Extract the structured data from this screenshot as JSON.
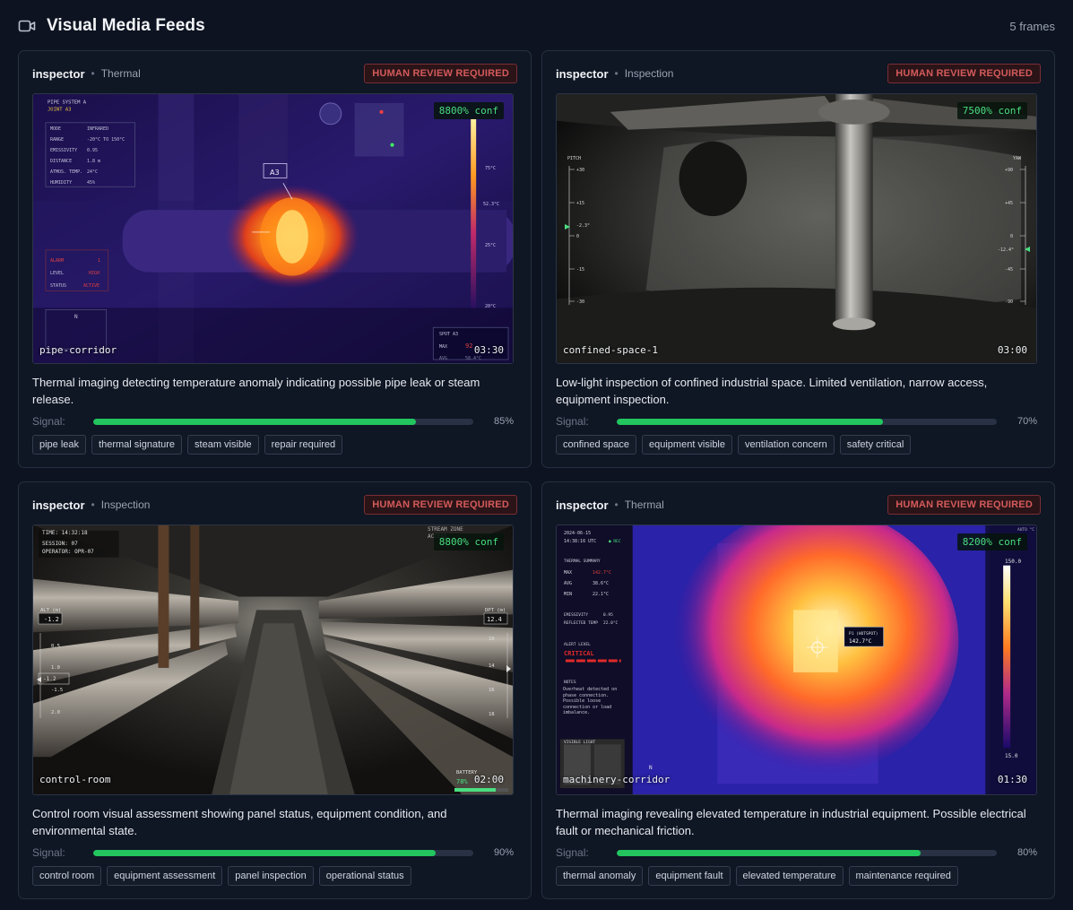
{
  "header": {
    "title": "Visual Media Feeds",
    "count": "5 frames",
    "icon": "video-camera-icon"
  },
  "review_label": "HUMAN REVIEW REQUIRED",
  "signal_label": "Signal:",
  "colors": {
    "signal": "#22c55e",
    "review": "#d45a5a",
    "confidence": "#4ade80"
  },
  "cards": [
    {
      "author": "inspector",
      "kind": "Thermal",
      "confidence": "8800% conf",
      "feed": "pipe-corridor",
      "duration": "03:30",
      "description": "Thermal imaging detecting temperature anomaly indicating possible pipe leak or steam release.",
      "signal_value": 0.85,
      "signal_pct": "85%",
      "tags": [
        "pipe leak",
        "thermal signature",
        "steam visible",
        "repair required"
      ],
      "overlay": {
        "system": "PIPE SYSTEM A",
        "joint": "JOINT A3",
        "marker": "A3",
        "params": [
          [
            "MODE",
            "INFRARED"
          ],
          [
            "RANGE",
            "-20°C TO 150°C"
          ],
          [
            "EMISSIVITY",
            "0.95"
          ],
          [
            "DISTANCE",
            "1.8 m"
          ],
          [
            "ATMOS. TEMP.",
            "24°C"
          ],
          [
            "HUMIDITY",
            "45%"
          ]
        ],
        "alarm": [
          [
            "ALARM",
            "1"
          ],
          [
            "LEVEL",
            "HIGH"
          ],
          [
            "STATUS",
            "ACTIVE"
          ]
        ],
        "scale": [
          "75°C",
          "52.3°C",
          "25°C",
          "20°C"
        ],
        "compass": "N",
        "spot": "SPOT A3",
        "spot_max": "MAX",
        "spot_val": "92",
        "spot_avg": "AVG",
        "spot_avg_val": "58.4°C"
      }
    },
    {
      "author": "inspector",
      "kind": "Inspection",
      "confidence": "7500% conf",
      "feed": "confined-space-1",
      "duration": "03:00",
      "description": "Low-light inspection of confined industrial space. Limited ventilation, narrow access, equipment inspection.",
      "signal_value": 0.7,
      "signal_pct": "70%",
      "tags": [
        "confined space",
        "equipment visible",
        "ventilation concern",
        "safety critical"
      ],
      "overlay": {
        "pitch_label": "PITCH",
        "yaw_label": "YAW",
        "pitch_ticks": [
          "+30",
          "+15",
          "0",
          "-15",
          "-30"
        ],
        "pitch_value": "-2.3°",
        "yaw_ticks": [
          "+90",
          "+45",
          "0",
          "-45",
          "-90"
        ],
        "yaw_value": "-12.4°"
      }
    },
    {
      "author": "inspector",
      "kind": "Inspection",
      "confidence": "8800% conf",
      "feed": "control-room",
      "duration": "02:00",
      "description": "Control room visual assessment showing panel status, equipment condition, and environmental state.",
      "signal_value": 0.9,
      "signal_pct": "90%",
      "tags": [
        "control room",
        "equipment assessment",
        "panel inspection",
        "operational status"
      ],
      "overlay": {
        "time": "TIME: 14:32:18",
        "session": "SESSION: 07",
        "operator": "OPERATOR: OPR-07",
        "alt_label": "ALT (m)",
        "alt_value": "-1.2",
        "alt_ticks": [
          "0.5",
          "1.0",
          "-1.2",
          "-1.5",
          "2.0"
        ],
        "dpt_label": "DPT (m)",
        "dpt_value": "12.4",
        "dpt_ticks": [
          "10",
          "14",
          "16",
          "18"
        ],
        "battery_label": "BATTERY",
        "battery_value": "78%",
        "top_a": "STREAM ZONE",
        "top_b": "ACCESS"
      }
    },
    {
      "author": "inspector",
      "kind": "Thermal",
      "confidence": "8200% conf",
      "feed": "machinery-corridor",
      "duration": "01:30",
      "description": "Thermal imaging revealing elevated temperature in industrial equipment. Possible electrical fault or mechanical friction.",
      "signal_value": 0.8,
      "signal_pct": "80%",
      "tags": [
        "thermal anomaly",
        "equipment fault",
        "elevated temperature",
        "maintenance required"
      ],
      "overlay": {
        "date": "2024-06-15",
        "clock": "14:38:16 UTC",
        "rec": "● REC",
        "summary": "THERMAL SUMMARY",
        "stats": [
          [
            "MAX",
            "142.7°C"
          ],
          [
            "AVG",
            "38.6°C"
          ],
          [
            "MIN",
            "22.1°C"
          ]
        ],
        "emiss": [
          [
            "EMISSIVITY",
            "0.95"
          ],
          [
            "REFLECTED TEMP",
            "22.0°C"
          ]
        ],
        "alert_label": "ALERT LEVEL",
        "alert": "CRITICAL",
        "notes_label": "NOTES",
        "notes": "Overheat detected on phase connection. Possible loose connection or load imbalance.",
        "visible": "VISIBLE LIGHT",
        "hotspot": "P1 (HOTSPOT)",
        "hotspot_val": "142.7°C",
        "scale_top": "150.0",
        "scale_bot": "15.0",
        "unit": "AUTO °C",
        "compass": "N"
      }
    }
  ]
}
